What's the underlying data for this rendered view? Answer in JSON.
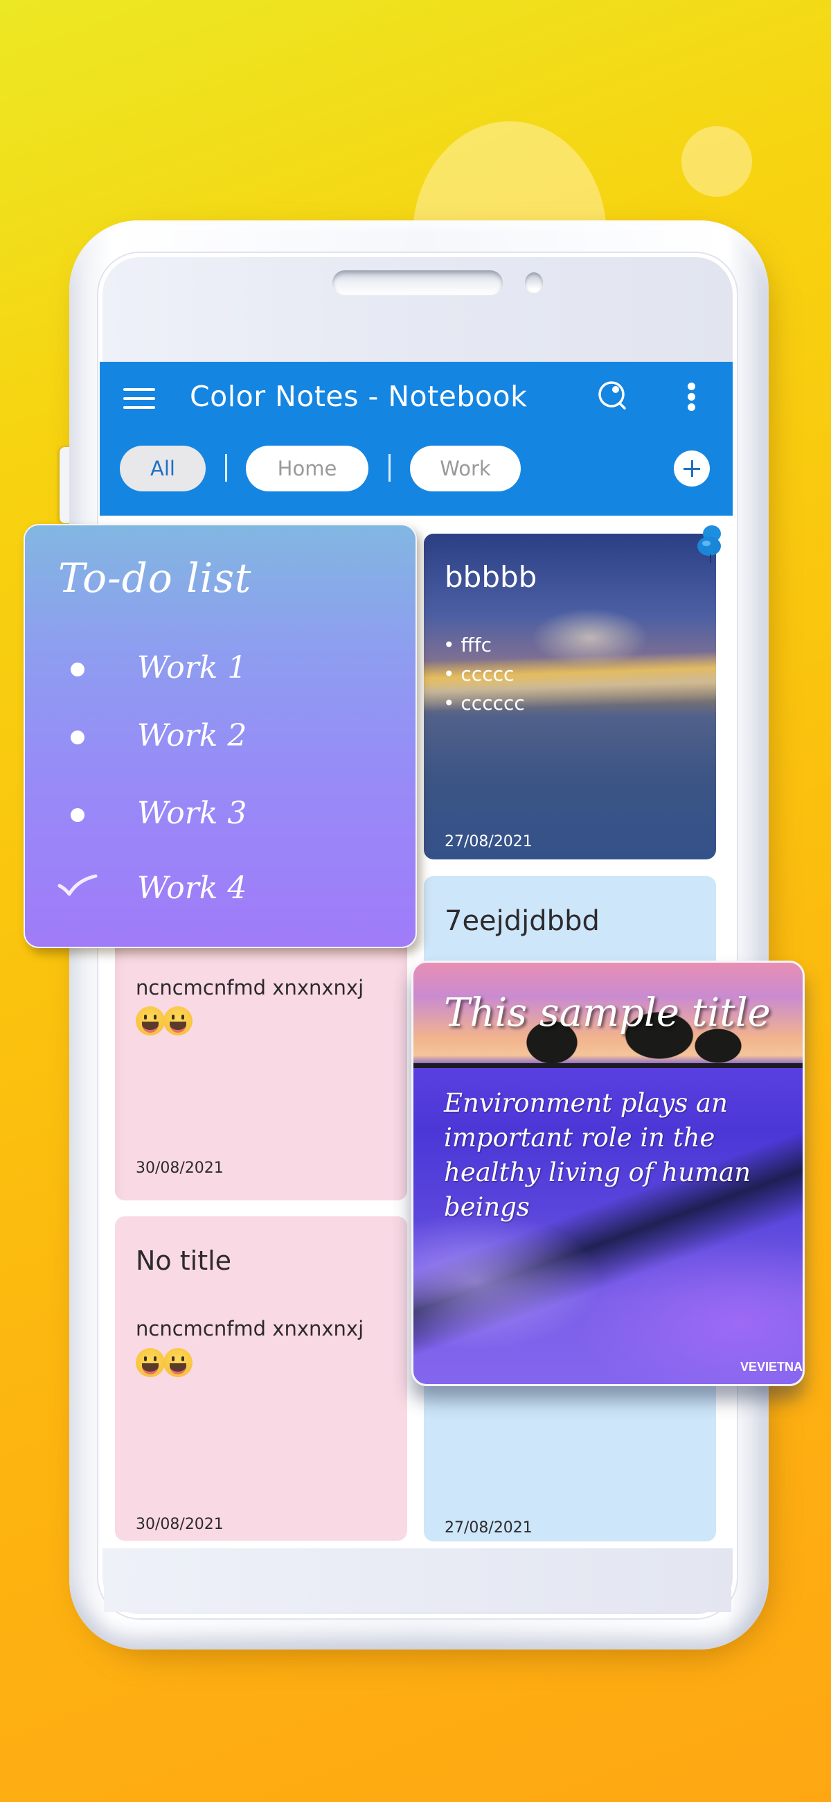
{
  "app": {
    "title": "Color Notes - Notebook",
    "accent_color": "#1585e2"
  },
  "toolbar": {
    "menu_icon": "hamburger-menu-icon",
    "search_icon": "search-icon",
    "more_icon": "more-vertical-icon"
  },
  "filters": {
    "chips": [
      {
        "label": "All",
        "selected": true
      },
      {
        "label": "Home",
        "selected": false
      },
      {
        "label": "Work",
        "selected": false
      }
    ],
    "add_icon": "plus-icon"
  },
  "notes": {
    "bbbbb": {
      "title": "bbbbb",
      "bullets": [
        "• fffc",
        "• ccccc",
        "• cccccc"
      ],
      "date": "27/08/2021",
      "pinned": true
    },
    "pink1": {
      "body": "ncncmcnfmd xnxnxnxj",
      "emojis": [
        "grinning-face",
        "grinning-face"
      ],
      "date": "30/08/2021",
      "color": "#f9d9e4"
    },
    "pink2": {
      "title": "No title",
      "body": "ncncmcnfmd xnxnxnxj",
      "emojis": [
        "grinning-face",
        "grinning-face"
      ],
      "date": "30/08/2021",
      "color": "#f9d9e4"
    },
    "blue1": {
      "title": "7eejdjdbbd",
      "date": "27/08/2021",
      "color": "#cde6f9"
    }
  },
  "todo_card": {
    "title": "To-do list",
    "items": [
      {
        "label": "Work 1",
        "checked": false
      },
      {
        "label": "Work 2",
        "checked": false
      },
      {
        "label": "Work 3",
        "checked": false
      },
      {
        "label": "Work 4",
        "checked": true
      }
    ]
  },
  "image_card": {
    "title": "This sample title",
    "body": "Environment plays an important role in the healthy living of human beings",
    "watermark": "VEVIETNA"
  }
}
